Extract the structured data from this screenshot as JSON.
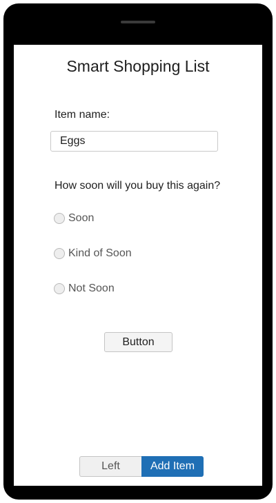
{
  "app": {
    "title": "Smart Shopping List"
  },
  "form": {
    "item_label": "Item name:",
    "item_value": "Eggs",
    "question": "How soon will you buy this again?",
    "options": [
      {
        "label": "Soon",
        "selected": false
      },
      {
        "label": "Kind of Soon",
        "selected": false
      },
      {
        "label": "Not Soon",
        "selected": false
      }
    ],
    "button_label": "Button"
  },
  "footer": {
    "left_label": "Left",
    "add_label": "Add Item",
    "active": "Add Item"
  },
  "colors": {
    "accent": "#1f6fb5",
    "device_frame": "#000000",
    "screen_bg": "#ffffff"
  }
}
